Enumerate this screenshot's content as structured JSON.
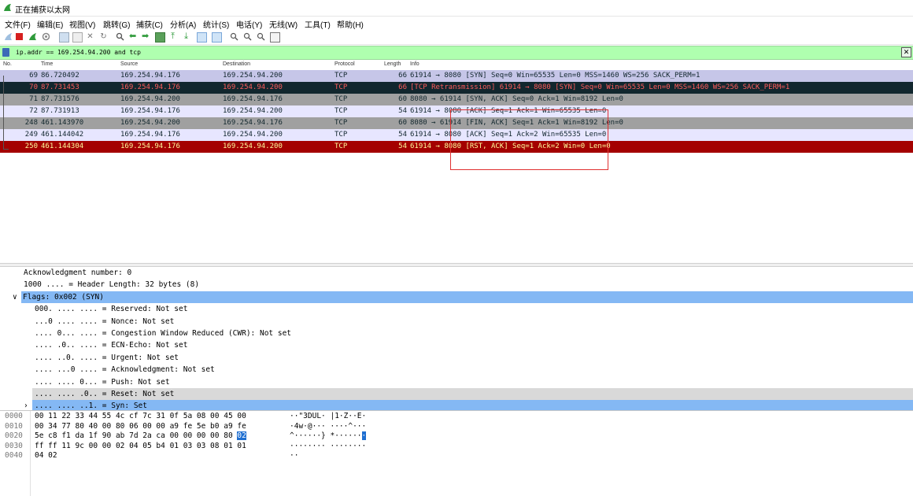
{
  "window": {
    "title": "正在捕获以太网"
  },
  "menu": [
    "文件(F)",
    "编辑(E)",
    "视图(V)",
    "跳转(G)",
    "捕获(C)",
    "分析(A)",
    "统计(S)",
    "电话(Y)",
    "无线(W)",
    "工具(T)",
    "帮助(H)"
  ],
  "filter": {
    "value": "ip.addr == 169.254.94.200 and tcp",
    "clear_icon": "✕"
  },
  "columns": [
    "No.",
    "Time",
    "Source",
    "Destination",
    "Protocol",
    "Length",
    "Info"
  ],
  "packets": [
    {
      "no": "69",
      "time": "86.720492",
      "src": "169.254.94.176",
      "dst": "169.254.94.200",
      "proto": "TCP",
      "len": "66",
      "info": "61914 → 8080 [SYN] Seq=0 Win=65535 Len=0 MSS=1460 WS=256 SACK_PERM=1",
      "bg": "#c6c6e8",
      "fg": "#12272e"
    },
    {
      "no": "70",
      "time": "87.731453",
      "src": "169.254.94.176",
      "dst": "169.254.94.200",
      "proto": "TCP",
      "len": "66",
      "info": "[TCP Retransmission] 61914 → 8080 [SYN] Seq=0 Win=65535 Len=0 MSS=1460 WS=256 SACK_PERM=1",
      "bg": "#12272e",
      "fg": "#ff5c5c"
    },
    {
      "no": "71",
      "time": "87.731576",
      "src": "169.254.94.200",
      "dst": "169.254.94.176",
      "proto": "TCP",
      "len": "60",
      "info": "8080 → 61914 [SYN, ACK] Seq=0 Ack=1 Win=8192 Len=0",
      "bg": "#a0a0a0",
      "fg": "#12272e"
    },
    {
      "no": "72",
      "time": "87.731913",
      "src": "169.254.94.176",
      "dst": "169.254.94.200",
      "proto": "TCP",
      "len": "54",
      "info": "61914 → 8080 [ACK] Seq=1 Ack=1 Win=65535 Len=0",
      "bg": "#e7e6ff",
      "fg": "#12272e"
    },
    {
      "no": "248",
      "time": "461.143970",
      "src": "169.254.94.200",
      "dst": "169.254.94.176",
      "proto": "TCP",
      "len": "60",
      "info": "8080 → 61914 [FIN, ACK] Seq=1 Ack=1 Win=8192 Len=0",
      "bg": "#a0a0a0",
      "fg": "#12272e"
    },
    {
      "no": "249",
      "time": "461.144042",
      "src": "169.254.94.176",
      "dst": "169.254.94.200",
      "proto": "TCP",
      "len": "54",
      "info": "61914 → 8080 [ACK] Seq=1 Ack=2 Win=65535 Len=0",
      "bg": "#e7e6ff",
      "fg": "#12272e"
    },
    {
      "no": "250",
      "time": "461.144304",
      "src": "169.254.94.176",
      "dst": "169.254.94.200",
      "proto": "TCP",
      "len": "54",
      "info": "61914 → 8080 [RST, ACK] Seq=1 Ack=2 Win=0 Len=0",
      "bg": "#a40000",
      "fg": "#fffc9c"
    }
  ],
  "details": [
    {
      "text": "Acknowledgment number: 0",
      "indent": 1,
      "style": "plain"
    },
    {
      "text": "1000 .... = Header Length: 32 bytes (8)",
      "indent": 1,
      "style": "plain"
    },
    {
      "text": "Flags: 0x002 (SYN)",
      "indent": 1,
      "style": "blue",
      "toggle": "∨"
    },
    {
      "text": "000. .... .... = Reserved: Not set",
      "indent": 2,
      "style": "plain"
    },
    {
      "text": "...0 .... .... = Nonce: Not set",
      "indent": 2,
      "style": "plain"
    },
    {
      "text": ".... 0... .... = Congestion Window Reduced (CWR): Not set",
      "indent": 2,
      "style": "plain"
    },
    {
      "text": ".... .0.. .... = ECN-Echo: Not set",
      "indent": 2,
      "style": "plain"
    },
    {
      "text": ".... ..0. .... = Urgent: Not set",
      "indent": 2,
      "style": "plain"
    },
    {
      "text": ".... ...0 .... = Acknowledgment: Not set",
      "indent": 2,
      "style": "plain"
    },
    {
      "text": ".... .... 0... = Push: Not set",
      "indent": 2,
      "style": "plain"
    },
    {
      "text": ".... .... .0.. = Reset: Not set",
      "indent": 2,
      "style": "gray"
    },
    {
      "text": ".... .... ..1. = Syn: Set",
      "indent": 2,
      "style": "blue",
      "toggle": "›"
    }
  ],
  "bytes": [
    {
      "offset": "0000",
      "hex": "00 11 22 33 44 55 4c cf  7c 31 0f 5a 08 00 45 00",
      "ascii": "··\"3DUL· |1·Z··E·"
    },
    {
      "offset": "0010",
      "hex": "00 34 77 80 40 00 80 06  00 00 a9 fe 5e b0 a9 fe",
      "ascii": "·4w·@··· ····^···"
    },
    {
      "offset": "0020",
      "hex": "5e c8 f1 da 1f 90 ab 7d  2a ca 00 00 00 00 80",
      "hex_hl": "02",
      "ascii": "^······} *······",
      "ascii_hl": "·"
    },
    {
      "offset": "0030",
      "hex": "ff ff 11 9c 00 00 02 04  05 b4 01 03 03 08 01 01",
      "ascii": "········ ········"
    },
    {
      "offset": "0040",
      "hex": "04 02",
      "ascii": "··"
    }
  ],
  "colors": {
    "filter_bg": "#afffaf",
    "selected_blue": "#84b8f4",
    "highlight_box": "#e03030"
  }
}
